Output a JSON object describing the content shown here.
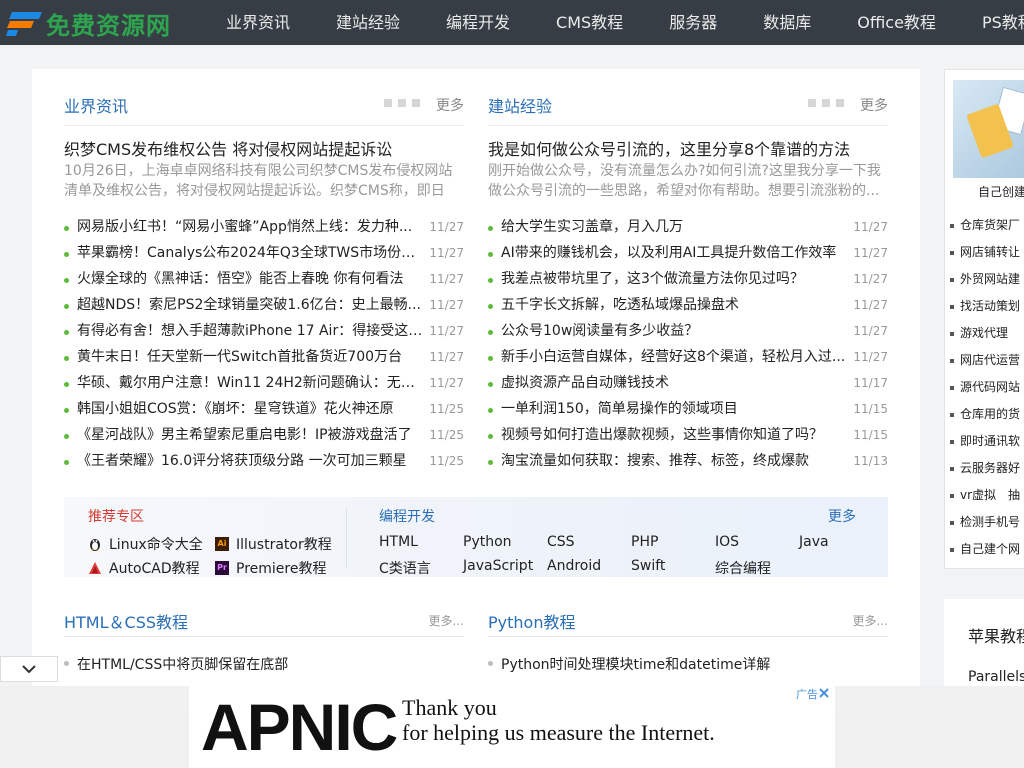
{
  "site": {
    "name": "免费资源网",
    "brand_color": "#2ea44f",
    "accent": "#2b6fb6"
  },
  "nav": {
    "items": [
      "业界资讯",
      "建站经验",
      "编程开发",
      "CMS教程",
      "服务器",
      "数据库",
      "Office教程",
      "PS教程"
    ]
  },
  "sections": [
    {
      "title": "业界资讯",
      "more": "更多",
      "featured": {
        "title": "织梦CMS发布维权公告 将对侵权网站提起诉讼",
        "summary": "10月26日，上海卓卓网络科技有限公司织梦CMS发布侵权网站清单及维权公告，将对侵权网站提起诉讼。织梦CMS称，即日起..."
      },
      "items": [
        {
          "title": "网易版小红书！“网易小蜜蜂”App悄然上线：发力种...",
          "date": "11/27"
        },
        {
          "title": "苹果霸榜！Canalys公布2024年Q3全球TWS市场份额...",
          "date": "11/27"
        },
        {
          "title": "火爆全球的《黑神话：悟空》能否上春晚 你有何看法",
          "date": "11/27"
        },
        {
          "title": "超越NDS！索尼PS2全球销量突破1.6亿台：史上最畅...",
          "date": "11/27"
        },
        {
          "title": "有得必有舍！想入手超薄款iPhone 17 Air：得接受这5...",
          "date": "11/27"
        },
        {
          "title": "黄牛末日！任天堂新一代Switch首批备货近700万台",
          "date": "11/27"
        },
        {
          "title": "华硕、戴尔用户注意！Win11 24H2新问题确认：无法...",
          "date": "11/27"
        },
        {
          "title": "韩国小姐姐COS赏：《崩坏：星穹铁道》花火神还原",
          "date": "11/25"
        },
        {
          "title": "《星河战队》男主希望索尼重启电影！IP被游戏盘活了",
          "date": "11/25"
        },
        {
          "title": "《王者荣耀》16.0评分将获顶级分路 一次可加三颗星",
          "date": "11/25"
        }
      ]
    },
    {
      "title": "建站经验",
      "more": "更多",
      "featured": {
        "title": "我是如何做公众号引流的，这里分享8个靠谱的方法",
        "summary": "刚开始做公众号，没有流量怎么办?如何引流?这里我分享一下我做公众号引流的一些思路，希望对你有帮助。想要引流涨粉的..."
      },
      "items": [
        {
          "title": "给大学生实习盖章，月入几万",
          "date": "11/27"
        },
        {
          "title": "AI带来的赚钱机会，以及利用AI工具提升数倍工作效率",
          "date": "11/27"
        },
        {
          "title": "我差点被带坑里了，这3个做流量方法你见过吗？",
          "date": "11/27"
        },
        {
          "title": "五千字长文拆解，吃透私域爆品操盘术",
          "date": "11/27"
        },
        {
          "title": "公众号10w阅读量有多少收益？",
          "date": "11/27"
        },
        {
          "title": "新手小白运营自媒体，经营好这8个渠道，轻松月入过...",
          "date": "11/27"
        },
        {
          "title": "虚拟资源产品自动赚钱技术",
          "date": "11/17"
        },
        {
          "title": "一单利润150，简单易操作的领域项目",
          "date": "11/15"
        },
        {
          "title": "视频号如何打造出爆款视频，这些事情你知道了吗？",
          "date": "11/15"
        },
        {
          "title": "淘宝流量如何获取：搜索、推荐、标签，终成爆款",
          "date": "11/13"
        }
      ]
    }
  ],
  "recommend": {
    "title": "推荐专区",
    "items": [
      {
        "label": "Linux命令大全",
        "icon": "linux-icon"
      },
      {
        "label": "Illustrator教程",
        "icon": "illustrator-icon"
      },
      {
        "label": "AutoCAD教程",
        "icon": "autocad-icon"
      },
      {
        "label": "Premiere教程",
        "icon": "premiere-icon"
      }
    ],
    "ai_text": "Ai",
    "pr_text": "Pr"
  },
  "dev": {
    "title": "编程开发",
    "more": "更多",
    "links": [
      "HTML",
      "Python",
      "CSS",
      "PHP",
      "IOS",
      "Java",
      "C类语言",
      "JavaScript",
      "Android",
      "Swift",
      "综合编程"
    ]
  },
  "bottom_sections": [
    {
      "title": "HTML＆CSS教程",
      "more": "更多...",
      "first_item": "在HTML/CSS中将页脚保留在底部"
    },
    {
      "title": "Python教程",
      "more": "更多...",
      "first_item": "Python时间处理模块time和datetime详解"
    }
  ],
  "sidebar": {
    "caption": "自己创建",
    "items": [
      "仓库货架厂",
      "网店铺转让",
      "外贸网站建",
      "找活动策划",
      "游戏代理",
      "网店代运营",
      "源代码网站",
      "仓库用的货",
      "即时通讯软",
      "云服务器好",
      "vr虚拟　抽",
      "检测手机号",
      "自己建个网"
    ],
    "section2_title": "苹果教程",
    "section2_item": "Parallels"
  },
  "ad": {
    "logo": "APNIC",
    "line1": "Thank you",
    "line2": "for helping us measure the Internet.",
    "label": "广告"
  }
}
